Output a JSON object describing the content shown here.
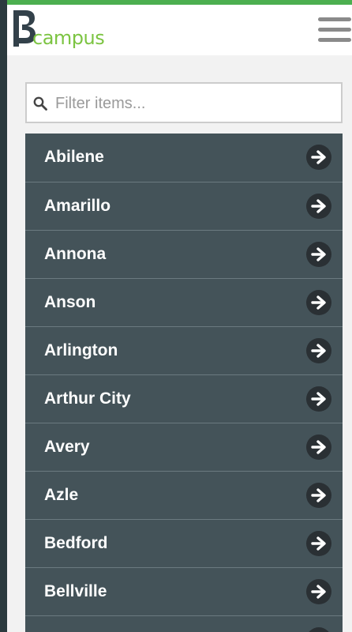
{
  "header": {
    "logo_mark": "B",
    "logo_text": "campus",
    "brand_color": "#7cc442",
    "accent_color": "#4caf50",
    "menu_icon": "hamburger-menu-icon"
  },
  "search": {
    "placeholder": "Filter items...",
    "value": "",
    "icon": "search-icon"
  },
  "list": {
    "item_icon": "arrow-right-circle-icon",
    "item_color": "#445359",
    "items": [
      {
        "label": "Abilene"
      },
      {
        "label": "Amarillo"
      },
      {
        "label": "Annona"
      },
      {
        "label": "Anson"
      },
      {
        "label": "Arlington"
      },
      {
        "label": "Arthur City"
      },
      {
        "label": "Avery"
      },
      {
        "label": "Azle"
      },
      {
        "label": "Bedford"
      },
      {
        "label": "Bellville"
      },
      {
        "label": ""
      }
    ]
  }
}
